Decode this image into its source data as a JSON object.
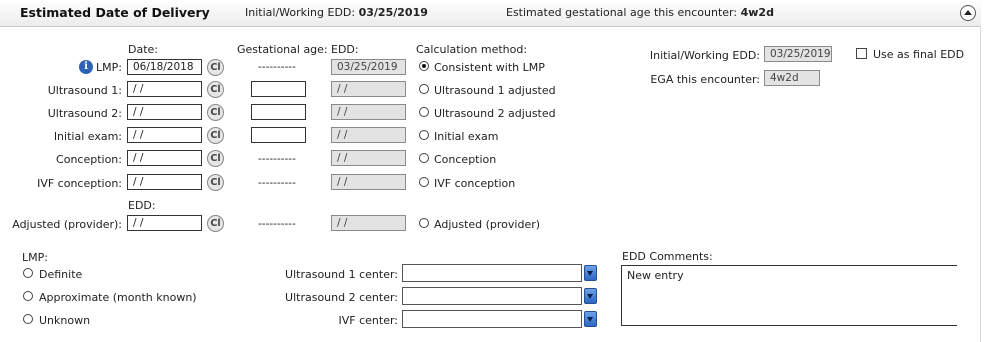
{
  "header": {
    "title": "Estimated Date of Delivery",
    "initial_label": "Initial/Working EDD:",
    "initial_value": "03/25/2019",
    "ega_label": "Estimated gestational age this encounter:",
    "ega_value": "4w2d"
  },
  "columns": {
    "date": "Date:",
    "gest_age": "Gestational age:",
    "edd": "EDD:",
    "calc_method": "Calculation method:",
    "edd_adjusted": "EDD:"
  },
  "rows": {
    "lmp": {
      "label": "LMP:",
      "date": "06/18/2018",
      "gest_age": "----------",
      "edd": "03/25/2019",
      "method": "Consistent with LMP",
      "method_selected": true
    },
    "us1": {
      "label": "Ultrasound 1:",
      "date": " / /",
      "gest_age": "",
      "edd": " / /",
      "method": "Ultrasound 1 adjusted",
      "method_selected": false
    },
    "us2": {
      "label": "Ultrasound 2:",
      "date": " / /",
      "gest_age": "",
      "edd": " / /",
      "method": "Ultrasound 2 adjusted",
      "method_selected": false
    },
    "initial": {
      "label": "Initial exam:",
      "date": " / /",
      "gest_age": "",
      "edd": " / /",
      "method": "Initial exam",
      "method_selected": false
    },
    "conception": {
      "label": "Conception:",
      "date": " / /",
      "gest_age": "----------",
      "edd": " / /",
      "method": "Conception",
      "method_selected": false
    },
    "ivf": {
      "label": "IVF conception:",
      "date": " / /",
      "gest_age": "----------",
      "edd": " / /",
      "method": "IVF conception",
      "method_selected": false
    },
    "adjusted": {
      "label": "Adjusted (provider):",
      "date": " / /",
      "gest_age": "----------",
      "edd": " / /",
      "method": "Adjusted (provider)",
      "method_selected": false
    }
  },
  "calendar_button": "Cl",
  "info_icon": "i",
  "summary": {
    "initial_label": "Initial/Working EDD:",
    "initial_value": "03/25/2019",
    "use_final_label": "Use as final EDD",
    "use_final_checked": false,
    "ega_label": "EGA this encounter:",
    "ega_value": "4w2d"
  },
  "lmp_certainty": {
    "label": "LMP:",
    "options": [
      "Definite",
      "Approximate (month known)",
      "Unknown"
    ]
  },
  "centers": {
    "us1_label": "Ultrasound 1 center:",
    "us2_label": "Ultrasound 2 center:",
    "ivf_label": "IVF center:"
  },
  "comments": {
    "label": "EDD Comments:",
    "value": "New entry"
  },
  "icons": {
    "info": "info-icon",
    "collapse": "chevron-up-icon",
    "dropdown": "chevron-down-icon"
  }
}
